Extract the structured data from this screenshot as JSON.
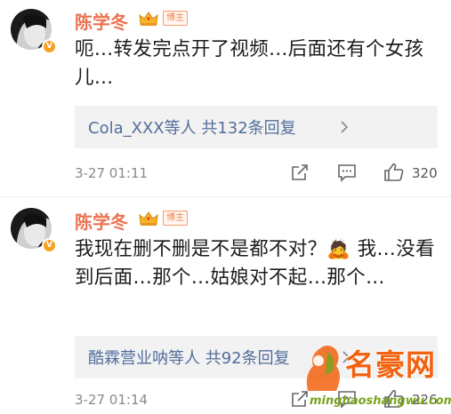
{
  "comments": [
    {
      "user": {
        "name": "陈学冬",
        "tag": "博主",
        "badge": "V"
      },
      "text": "呃…转发完点开了视频…后面还有个女孩儿…",
      "replies": {
        "summary": "Cola_XXX等人  共132条回复"
      },
      "time": "3-27 01:11",
      "actions": {
        "like_count": "320"
      }
    },
    {
      "user": {
        "name": "陈学冬",
        "tag": "博主",
        "badge": "V"
      },
      "text": "我现在删不删是不是都不对？🙇 我…没看到后面…那个…姑娘对不起…那个…",
      "replies": {
        "summary": "酷霖营业呐等人  共92条回复"
      },
      "time": "3-27 01:14",
      "actions": {
        "like_count": "226"
      }
    }
  ],
  "watermark": {
    "title": "名豪网",
    "url": "minghaoshangwu.com"
  },
  "icons": {
    "share": "share-icon",
    "reply": "comment-icon",
    "like": "thumbs-up-icon",
    "crown": "crown-icon",
    "chevron": "chevron-right-icon"
  },
  "colors": {
    "username": "#eb7350",
    "reply_link": "#526e9c",
    "meta": "#8a8a8a",
    "watermark_title": "#f2620f",
    "watermark_url": "#7aa321"
  }
}
